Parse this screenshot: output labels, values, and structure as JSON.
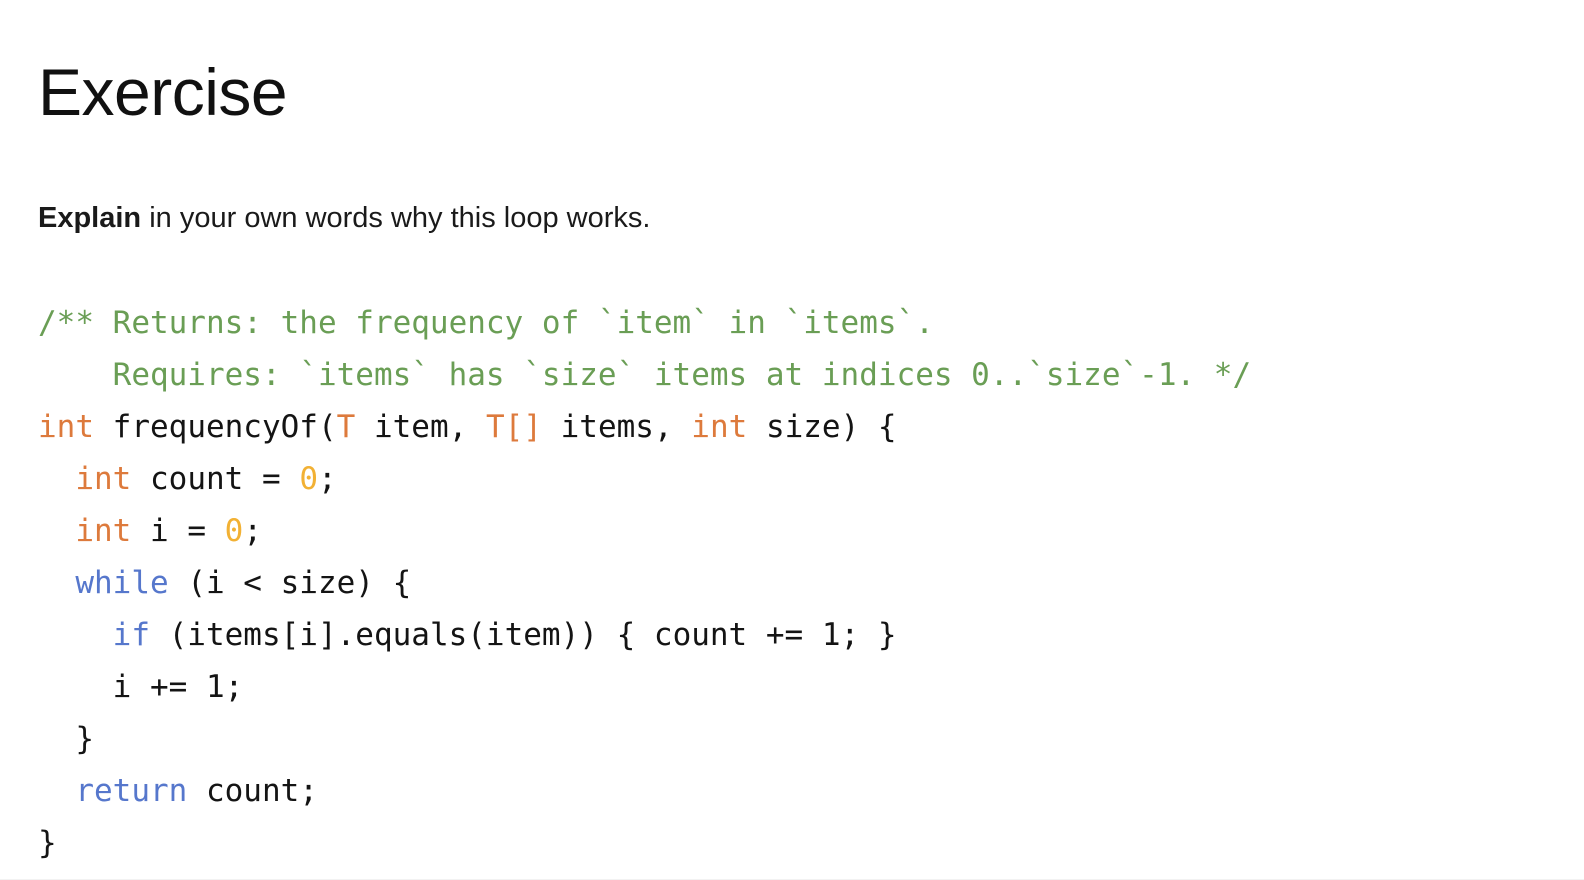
{
  "slide": {
    "title": "Exercise",
    "prompt": {
      "lead": "Explain",
      "rest": " in your own words why this loop works."
    }
  },
  "palette": {
    "comment": "#6A9E55",
    "type": "#DD7A3C",
    "number": "#F2B134",
    "keyword": "#5677CC",
    "plain": "#141414",
    "background": "#FFFFFF",
    "title": "#111111"
  },
  "code": {
    "language": "java",
    "lines": [
      {
        "index": 0,
        "text": "/** Returns: the frequency of `item` in `items`.",
        "tokens": [
          {
            "t": "/** Returns: the frequency of `item` in `items`.",
            "c": "comment"
          }
        ]
      },
      {
        "index": 1,
        "text": "    Requires: `items` has `size` items at indices 0..`size`-1. */",
        "tokens": [
          {
            "t": "    Requires: `items` has `size` items at indices 0..`size`-1. */",
            "c": "comment"
          }
        ]
      },
      {
        "index": 2,
        "text": "int frequencyOf(T item, T[] items, int size) {",
        "tokens": [
          {
            "t": "int",
            "c": "type"
          },
          {
            "t": " frequencyOf(",
            "c": "plain"
          },
          {
            "t": "T",
            "c": "type"
          },
          {
            "t": " item, ",
            "c": "plain"
          },
          {
            "t": "T[]",
            "c": "type"
          },
          {
            "t": " items, ",
            "c": "plain"
          },
          {
            "t": "int",
            "c": "type"
          },
          {
            "t": " size) {",
            "c": "plain"
          }
        ]
      },
      {
        "index": 3,
        "text": "  int count = 0;",
        "tokens": [
          {
            "t": "  ",
            "c": "plain"
          },
          {
            "t": "int",
            "c": "type"
          },
          {
            "t": " count = ",
            "c": "plain"
          },
          {
            "t": "0",
            "c": "number"
          },
          {
            "t": ";",
            "c": "plain"
          }
        ]
      },
      {
        "index": 4,
        "text": "  int i = 0;",
        "tokens": [
          {
            "t": "  ",
            "c": "plain"
          },
          {
            "t": "int",
            "c": "type"
          },
          {
            "t": " i = ",
            "c": "plain"
          },
          {
            "t": "0",
            "c": "number"
          },
          {
            "t": ";",
            "c": "plain"
          }
        ]
      },
      {
        "index": 5,
        "text": "  while (i < size) {",
        "tokens": [
          {
            "t": "  ",
            "c": "plain"
          },
          {
            "t": "while",
            "c": "keyword"
          },
          {
            "t": " (i < size) {",
            "c": "plain"
          }
        ]
      },
      {
        "index": 6,
        "text": "    if (items[i].equals(item)) { count += 1; }",
        "tokens": [
          {
            "t": "    ",
            "c": "plain"
          },
          {
            "t": "if",
            "c": "keyword"
          },
          {
            "t": " (items[i].equals(item)) { count += 1; }",
            "c": "plain"
          }
        ]
      },
      {
        "index": 7,
        "text": "    i += 1;",
        "tokens": [
          {
            "t": "    i += 1;",
            "c": "plain"
          }
        ]
      },
      {
        "index": 8,
        "text": "  }",
        "tokens": [
          {
            "t": "  }",
            "c": "plain"
          }
        ]
      },
      {
        "index": 9,
        "text": "  return count;",
        "tokens": [
          {
            "t": "  ",
            "c": "plain"
          },
          {
            "t": "return",
            "c": "keyword"
          },
          {
            "t": " count;",
            "c": "plain"
          }
        ]
      },
      {
        "index": 10,
        "text": "}",
        "tokens": [
          {
            "t": "}",
            "c": "plain"
          }
        ]
      }
    ]
  }
}
